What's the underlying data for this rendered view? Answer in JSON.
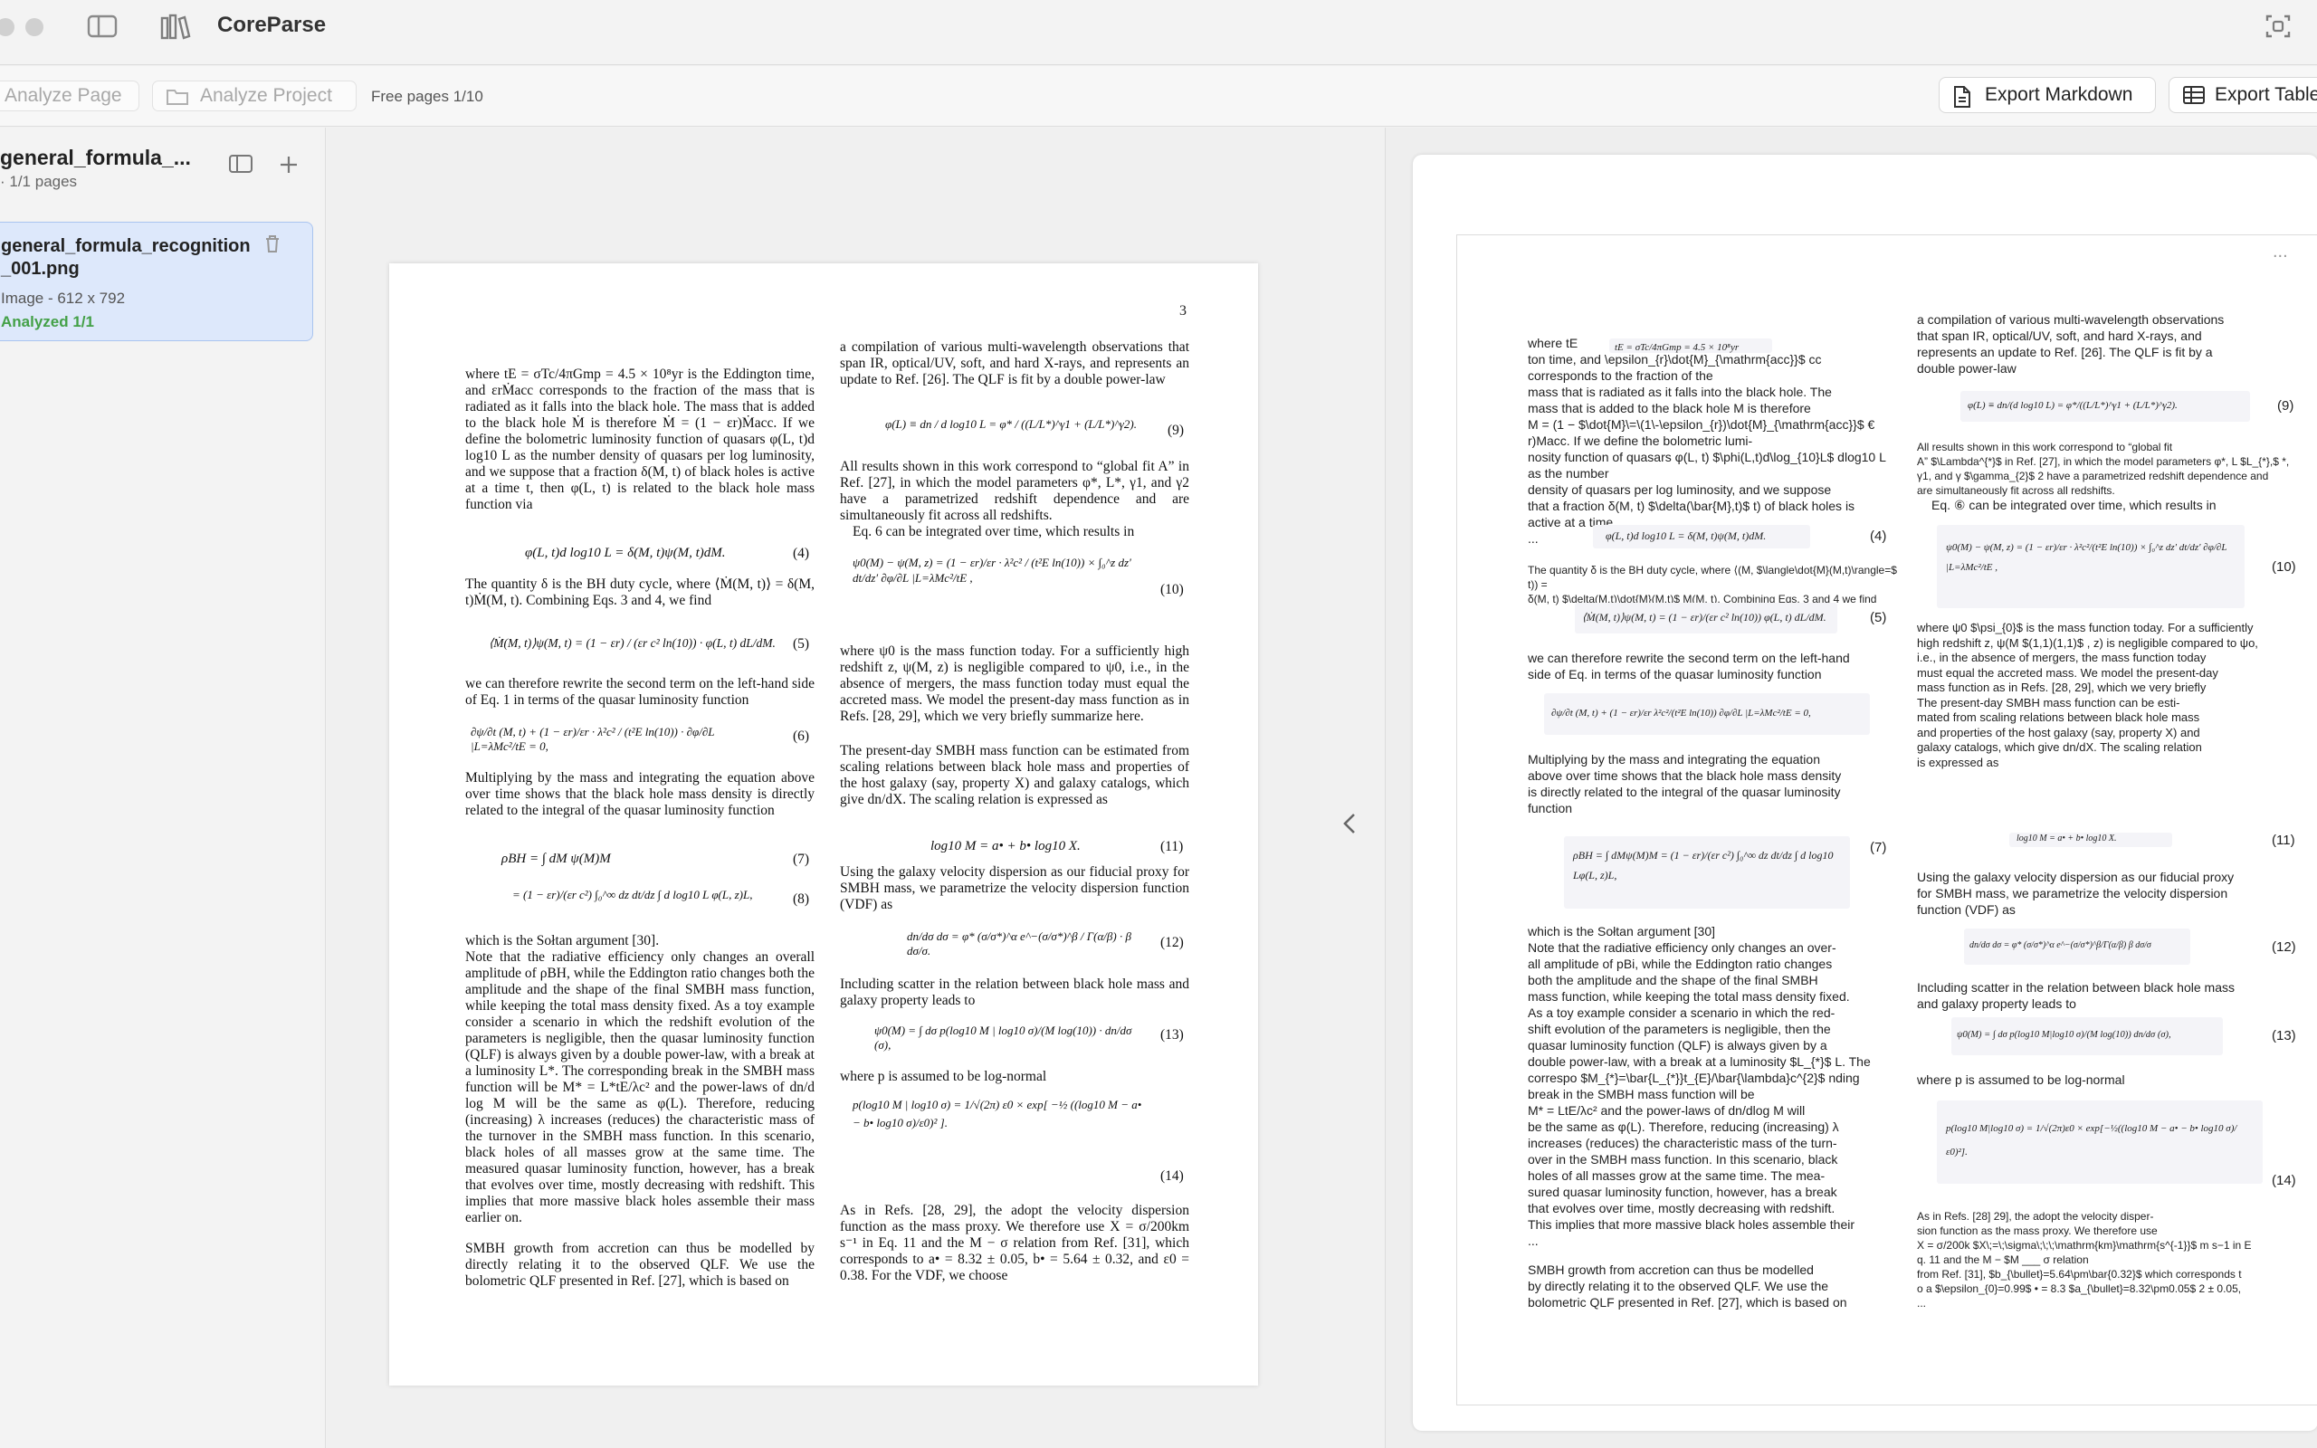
{
  "app": {
    "title": "CoreParse"
  },
  "toolbar": {
    "analyze_page": "Analyze Page",
    "analyze_project": "Analyze Project",
    "free_pages": "Free pages 1/10",
    "export_markdown": "Export Markdown",
    "export_table": "Export Table"
  },
  "sidebar": {
    "project_name": "general_formula_...",
    "project_pages": "· 1/1 pages",
    "file": {
      "name": "general_formula_recognition_001.png",
      "meta": "Image - 612 x 792",
      "status": "Analyzed 1/1"
    }
  },
  "source_page": {
    "page_number": "3",
    "left_column": [
      "where tE = σTc/4πGmp = 4.5 × 10⁸yr is the Eddington time, and εrṀacc corresponds to the fraction of the mass that is radiated as it falls into the black hole. The mass that is added to the black hole Ṁ is therefore Ṁ = (1 − εr)Ṁacc. If we define the bolometric luminosity function of quasars φ(L, t)d log10 L as the number density of quasars per log luminosity, and we suppose that a fraction δ(M, t) of black holes is active at a time t, then φ(L, t) is related to the black hole mass function via",
      "The quantity δ is the BH duty cycle, where ⟨Ṁ(M, t)⟩ = δ(M, t)Ṁ(M, t). Combining Eqs. 3 and 4, we find",
      "we can therefore rewrite the second term on the left-hand side of Eq. 1 in terms of the quasar luminosity function",
      "Multiplying by the mass and integrating the equation above over time shows that the black hole mass density is directly related to the integral of the quasar luminosity function",
      "which is the Sołtan argument [30].",
      "Note that the radiative efficiency only changes an overall amplitude of ρBH, while the Eddington ratio changes both the amplitude and the shape of the final SMBH mass function, while keeping the total mass density fixed. As a toy example consider a scenario in which the redshift evolution of the parameters is negligible, then the quasar luminosity function (QLF) is always given by a double power-law, with a break at a luminosity L*. The corresponding break in the SMBH mass function will be M* = L*tE/λc² and the power-laws of dn/d log M will be the same as φ(L). Therefore, reducing (increasing) λ increases (reduces) the characteristic mass of the turnover in the SMBH mass function. In this scenario, black holes of all masses grow at the same time. The measured quasar luminosity function, however, has a break that evolves over time, mostly decreasing with redshift. This implies that more massive black holes assemble their mass earlier on.",
      "SMBH growth from accretion can thus be modelled by directly relating it to the observed QLF. We use the bolometric QLF presented in Ref. [27], which is based on"
    ],
    "right_column": [
      "a compilation of various multi-wavelength observations that span IR, optical/UV, soft, and hard X-rays, and represents an update to Ref. [26]. The QLF is fit by a double power-law",
      "All results shown in this work correspond to “global fit A” in Ref. [27], in which the model parameters φ*, L*, γ1, and γ2 have a parametrized redshift dependence and are simultaneously fit across all redshifts.",
      "Eq. 6 can be integrated over time, which results in",
      "where ψ0 is the mass function today. For a sufficiently high redshift z, ψ(M, z) is negligible compared to ψ0, i.e., in the absence of mergers, the mass function today must equal the accreted mass. We model the present-day mass function as in Refs. [28, 29], which we very briefly summarize here.",
      "The present-day SMBH mass function can be estimated from scaling relations between black hole mass and properties of the host galaxy (say, property X) and galaxy catalogs, which give dn/dX. The scaling relation is expressed as",
      "Using the galaxy velocity dispersion as our fiducial proxy for SMBH mass, we parametrize the velocity dispersion function (VDF) as",
      "Including scatter in the relation between black hole mass and galaxy property leads to",
      "where p is assumed to be log-normal",
      "As in Refs. [28, 29], the adopt the velocity dispersion function as the mass proxy. We therefore use X = σ/200km s⁻¹ in Eq. 11 and the M − σ relation from Ref. [31], which corresponds to a• = 8.32 ± 0.05, b• = 5.64 ± 0.32, and ε0 = 0.38. For the VDF, we choose"
    ],
    "equations": [
      {
        "tex": "φ(L, t)d log10 L = δ(M, t)ψ(M, t)dM.",
        "no": "(4)"
      },
      {
        "tex": "⟨Ṁ(M, t)⟩ψ(M, t) = (1 − εr) / (εr c² ln(10)) · φ(L, t) dL/dM.",
        "no": "(5)"
      },
      {
        "tex": "∂ψ/∂t (M, t) + (1 − εr)/εr · λ²c² / (t²E ln(10)) · ∂φ/∂L |L=λMc²/tE = 0,",
        "no": "(6)"
      },
      {
        "tex": "ρBH = ∫ dM ψ(M)M",
        "no": "(7)"
      },
      {
        "tex": "= (1 − εr)/(εr c²) ∫₀^∞ dz dt/dz ∫ d log10 L φ(L, z)L,",
        "no": "(8)"
      },
      {
        "tex": "φ(L) ≡ dn / d log10 L = φ* / ((L/L*)^γ1 + (L/L*)^γ2).",
        "no": "(9)"
      },
      {
        "tex": "ψ0(M) − ψ(M, z) = (1 − εr)/εr · λ²c² / (t²E ln(10)) × ∫₀^z dz′ dt/dz′ ∂φ/∂L |L=λMc²/tE ,",
        "no": "(10)"
      },
      {
        "tex": "log10 M = a• + b• log10 X.",
        "no": "(11)"
      },
      {
        "tex": "dn/dσ dσ = φ* (σ/σ*)^α e^−(σ/σ*)^β / Γ(α/β) · β dσ/σ.",
        "no": "(12)"
      },
      {
        "tex": "ψ0(M) = ∫ dσ p(log10 M | log10 σ)/(M log(10)) · dn/dσ (σ),",
        "no": "(13)"
      },
      {
        "tex": "p(log10 M | log10 σ) = 1/√(2π) ε0 × exp[ −½ ((log10 M − a• − b• log10 σ)/ε0)² ].",
        "no": "(14)"
      }
    ]
  },
  "result": {
    "menu": "...",
    "left_blocks": [
      "where tE",
      "ton time, and \\epsilon_{r}\\dot{M}_{\\mathrm{acc}}$ cc corresponds to the fraction of the",
      "mass that is radiated as it falls into the black hole. The",
      "mass that is added to the black hole M is therefore",
      "M = (1 − $\\dot{M}\\=\\(1\\-\\epsilon_{r})\\dot{M}_{\\mathrm{acc}}$ € r)Macc. If we define the bolometric lumi-",
      "nosity function of quasars φ(L, t) $\\phi(L,t)d\\log_{10}L$ dlog10 L as the number",
      "density of quasars per log luminosity, and we suppose",
      "that a fraction δ(M, t) $\\delta(\\bar{M},t)$ t) of black holes is active at a time",
      "..."
    ],
    "left_blocks_2": [
      "The quantity δ is the BH duty cycle, where ⟨(M, $\\langle\\dot{M}(M,t)\\rangle=$ t)) =",
      "δ(M, t) $\\delta(M,t)\\dot{M}(M,t)$ M(M, t). Combining Eqs. 3 and 4 we find"
    ],
    "left_blocks_3": [
      "we can therefore rewrite the second term on the left-hand",
      "side of Eq.  in terms of the quasar luminosity function"
    ],
    "left_blocks_4": [
      "Multiplying by the mass and integrating the equation",
      "above over time shows that the black hole mass density",
      "is directly related to the integral of the quasar luminosity",
      "function"
    ],
    "left_blocks_5": [
      "which is the Sołtan argument [30]",
      "Note that the radiative efficiency only changes an over-",
      "all amplitude of pBi, while the Eddington ratio changes",
      "both the amplitude and the shape of the final SMBH",
      "mass function, while keeping the total mass density fixed.",
      "As a toy example consider a scenario in which the red-",
      "shift evolution of the parameters is negligible, then the",
      "quasar luminosity function (QLF) is always given by a",
      "double power-law, with a break at a luminosity $L_{*}$ L. The",
      "correspo $M_{*}=\\bar{L_{*}}t_{E}/\\bar{\\lambda}c^{2}$ nding",
      "break in the SMBH mass function will be",
      "M* = LtE/λc² and the power-laws of dn/dlog M will",
      "be the same as φ(L). Therefore, reducing (increasing) λ",
      "increases (reduces) the characteristic mass of the turn-",
      "over in the SMBH mass function. In this scenario, black",
      "holes of all masses grow at the same time. The mea-",
      "sured quasar luminosity function, however, has a break",
      "that evolves over time, mostly decreasing with redshift.",
      "This implies that more massive black holes assemble their",
      "..."
    ],
    "left_blocks_6": [
      "SMBH growth from accretion can thus be modelled",
      "by directly relating it to the observed QLF. We use the",
      "bolometric QLF presented in Ref. [27], which is based on"
    ],
    "right_blocks": [
      "a compilation of various multi-wavelength observations",
      "that span IR, optical/UV, soft, and hard X-rays, and",
      "represents an update to Ref. [26]. The QLF is fit by a",
      "double power-law"
    ],
    "right_blocks_2": [
      "All results shown in this work correspond to “global fit",
      "A” $\\Lambda^{*}$ in Ref. [27], in which the model parameters φ*, L $L_{*},$ *,",
      "γ1, and γ $\\gamma_{2}$ 2 have a parametrized redshift dependence and",
      "are simultaneously fit across all redshifts.",
      "Eq. ⑥ can be integrated over time, which results in"
    ],
    "right_blocks_3": [
      "where ψ0 $\\psi_{0}$ is the mass function today. For a sufficiently",
      "high redshift z, ψ(M $(1,1)(1,1)$ , z) is negligible compared to ψo,",
      "i.e., in the absence of mergers, the mass function today",
      "must equal the accreted mass. We model the present-day",
      "mass function as in Refs. [28, 29], which we very briefly",
      "The present-day SMBH mass function can be esti-",
      "mated from scaling relations between black hole mass",
      "and properties of the host galaxy (say, property X) and",
      "galaxy catalogs, which give dn/dX. The scaling relation",
      "is expressed as"
    ],
    "right_blocks_4": [
      "Using the galaxy velocity dispersion as our fiducial proxy",
      "for SMBH mass, we parametrize the velocity dispersion",
      "function (VDF) as"
    ],
    "right_blocks_5": [
      "Including scatter in the relation between black hole mass",
      "and galaxy property leads to"
    ],
    "right_blocks_6": [
      "where p is assumed to be log-normal"
    ],
    "right_blocks_7": [
      "As in Refs. [28] 29], the adopt the velocity disper-",
      "sion function as the mass proxy. We therefore use",
      "X = σ/200k $X\\;=\\;\\sigma\\;\\;\\;\\mathrm{km}\\mathrm{s^{-1}}$ m s−1 in E",
      "q. 11 and the M − $M  ___ σ relation",
      "from Ref. [31], $b_{\\bullet}=5.64\\pm\\bar{0.32}$ which corresponds t",
      "o a $\\epsilon_{0}=0.99$ • = 8.3 $a_{\\bullet}=8.32\\pm0.05$ 2 ± 0.05,",
      "..."
    ],
    "equations": [
      {
        "tex": "tE = σTc/4πGmp = 4.5 × 10⁸yr",
        "no": ""
      },
      {
        "tex": "φ(L, t)d log10 L = δ(M, t)ψ(M, t)dM.",
        "no": "(4)"
      },
      {
        "tex": "⟨Ṁ(M, t)⟩ψ(M, t) = (1 − εr)/(εr c² ln(10)) φ(L, t) dL/dM.",
        "no": "(5)"
      },
      {
        "tex": "∂ψ/∂t (M, t) + (1 − εr)/εr λ²c²/(t²E ln(10)) ∂φ/∂L |L=λMc²/tE = 0,",
        "no": ""
      },
      {
        "tex": "ρBH = ∫ dMψ(M)M = (1 − εr)/(εr c²) ∫₀^∞ dz dt/dz ∫ d log10 Lφ(L, z)L,",
        "no": "(7)"
      },
      {
        "tex": "φ(L) ≡ dn/(d log10 L) = φ*/((L/L*)^γ1 + (L/L*)^γ2).",
        "no": "(9)"
      },
      {
        "tex": "ψ0(M) − ψ(M, z) = (1 − εr)/εr · λ²c²/(t²E ln(10)) × ∫₀^z dz′ dt/dz′ ∂φ/∂L |L=λMc²/tE ,",
        "no": "(10)"
      },
      {
        "tex": "log10 M = a• + b• log10 X.",
        "no": "(11)"
      },
      {
        "tex": "dn/dσ dσ = φ* (σ/σ*)^α e^−(σ/σ*)^β/Γ(α/β) β dσ/σ",
        "no": "(12)"
      },
      {
        "tex": "ψ0(M) = ∫ dσ p(log10 M|log10 σ)/(M log(10)) dn/dσ (σ),",
        "no": "(13)"
      },
      {
        "tex": "p(log10 M|log10 σ) = 1/√(2π)ε0 × exp[−½((log10 M − a• − b• log10 σ)/ε0)²].",
        "no": "(14)"
      }
    ]
  }
}
